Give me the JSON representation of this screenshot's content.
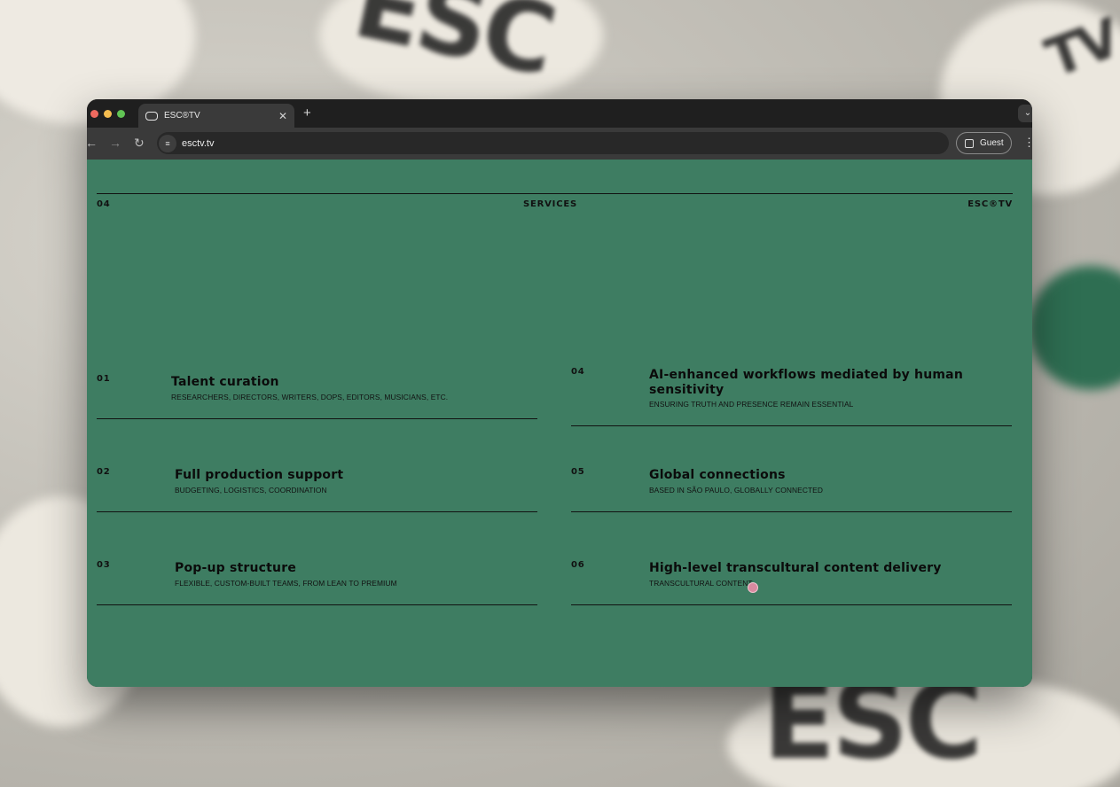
{
  "browser": {
    "tab_title": "ESC®TV",
    "new_tab": "+",
    "tab_close": "✕",
    "url": "esctv.tv",
    "profile_label": "Guest",
    "back": "←",
    "forward": "→",
    "reload": "↻",
    "menu": "⋮",
    "tab_search": "⌄"
  },
  "page": {
    "background_color": "#3e7d62",
    "header": {
      "left": "04",
      "center": "SERVICES",
      "right": "ESC®TV"
    },
    "services": [
      {
        "num": "01",
        "title": "Talent curation",
        "subtitle": "RESEARCHERS, DIRECTORS, WRITERS, DOPS, EDITORS, MUSICIANS, ETC."
      },
      {
        "num": "02",
        "title": "Full production support",
        "subtitle": "BUDGETING, LOGISTICS, COORDINATION"
      },
      {
        "num": "03",
        "title": "Pop-up structure",
        "subtitle": "FLEXIBLE, CUSTOM-BUILT TEAMS, FROM LEAN TO PREMIUM"
      },
      {
        "num": "04",
        "title": "AI-enhanced workflows mediated by human sensitivity",
        "subtitle": "ENSURING TRUTH AND PRESENCE REMAIN ESSENTIAL"
      },
      {
        "num": "05",
        "title": "Global connections",
        "subtitle": "BASED IN SÃO PAULO, GLOBALLY CONNECTED"
      },
      {
        "num": "06",
        "title": "High-level transcultural content delivery",
        "subtitle": "TRANSCULTURAL CONTENT"
      }
    ]
  },
  "background_stickers": [
    "ESC",
    "TV"
  ]
}
